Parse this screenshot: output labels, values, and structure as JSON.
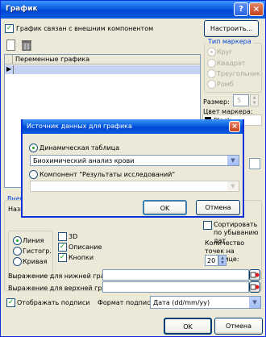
{
  "window": {
    "title": "График",
    "minimize_glyph": "?",
    "close_glyph": "×"
  },
  "top": {
    "linked_checkbox_label": "График связан с внешним компонентом",
    "configure_button": "Настроить..."
  },
  "variables_table": {
    "column_header": "Переменные графика"
  },
  "marker_type": {
    "group_label": "Тип маркера",
    "options": [
      "Круг",
      "Квадрат",
      "Треугольник",
      "Ромб"
    ],
    "selected": "Круг"
  },
  "size": {
    "label": "Размер:",
    "value": "5"
  },
  "marker_color": {
    "label": "Цвет маркера:",
    "value": "Black"
  },
  "data_source_dialog": {
    "title": "Источник данных для графика",
    "close_glyph": "×",
    "option_dynamic_table": "Динамическая таблица",
    "dynamic_table_value": "Биохимический анализ крови",
    "option_component": "Компонент \"Результаты исследований\"",
    "component_value": "",
    "ok_button": "OK",
    "cancel_button": "Отмена"
  },
  "hidden_partial": {
    "group_label_fragment": "Внеш",
    "name_label_fragment": "Назв"
  },
  "sort": {
    "label": "Сортировать по убыванию дат",
    "checked": false
  },
  "chart_kind": {
    "options": [
      "Линия",
      "Гистогр.",
      "Кривая"
    ],
    "selected": "Линия"
  },
  "options": {
    "three_d": "3D",
    "description": "Описание",
    "buttons": "Кнопки"
  },
  "points_per_page": {
    "label": "Количество точек на странице:",
    "value": "20"
  },
  "bounds": {
    "lower_label": "Выражение для нижней границы:",
    "upper_label": "Выражение для верхней границы:",
    "lower_value": "",
    "upper_value": ""
  },
  "captions": {
    "show_label": "Отображать подписи",
    "format_label": "Формат подписи:",
    "format_value": "Дата (dd/mm/yy)"
  },
  "footer": {
    "ok_button": "OK",
    "cancel_button": "Отмена"
  },
  "colors": {
    "title_blue": "#0a5ddc",
    "face": "#ece9d8",
    "selection": "#c5d2f3",
    "check_green": "#21a121"
  }
}
